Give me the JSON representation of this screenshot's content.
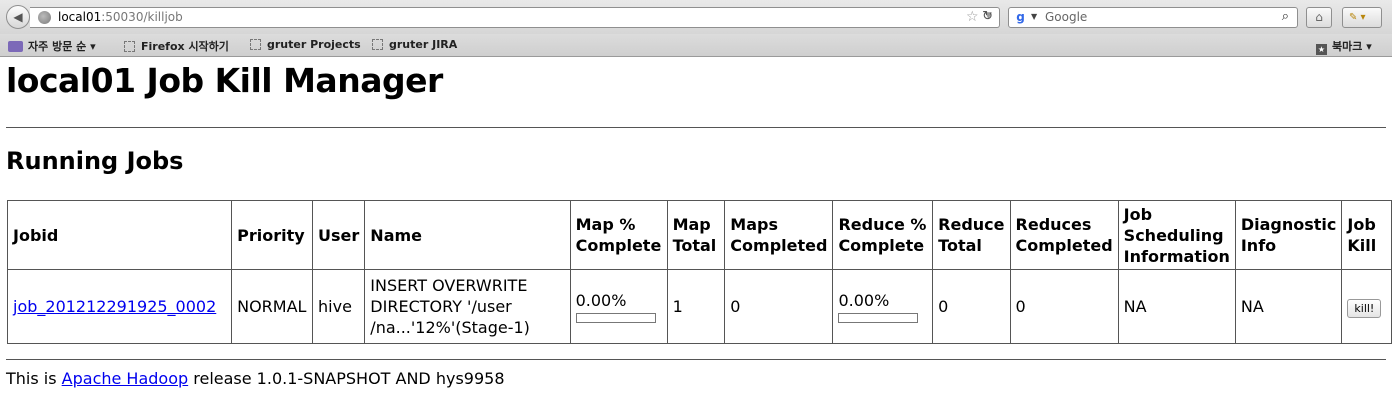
{
  "browser": {
    "url_host": "local01",
    "url_rest": ":50030/killjob",
    "search_placeholder": "Google",
    "bookmarks": [
      {
        "label": "자주 방문 순 ▾"
      },
      {
        "label": "Firefox 시작하기"
      },
      {
        "label": "gruter Projects"
      },
      {
        "label": "gruter JIRA"
      }
    ],
    "bookmarks_menu_label": "북마크 ▾"
  },
  "page": {
    "title": "local01 Job Kill Manager",
    "section_title": "Running Jobs"
  },
  "table": {
    "headers": {
      "jobid": "Jobid",
      "priority": "Priority",
      "user": "User",
      "name": "Name",
      "map_pct_1": "Map %",
      "map_pct_2": "Complete",
      "map_total_1": "Map",
      "map_total_2": "Total",
      "maps_completed_1": "Maps",
      "maps_completed_2": "Completed",
      "reduce_pct_1": "Reduce %",
      "reduce_pct_2": "Complete",
      "reduce_total_1": "Reduce",
      "reduce_total_2": "Total",
      "reduces_completed_1": "Reduces",
      "reduces_completed_2": "Completed",
      "sched_1": "Job",
      "sched_2": "Scheduling",
      "sched_3": "Information",
      "diag_1": "Diagnostic",
      "diag_2": "Info",
      "kill_1": "Job",
      "kill_2": "Kill"
    },
    "rows": [
      {
        "jobid": "job_201212291925_0002",
        "priority": "NORMAL",
        "user": "hive",
        "name_1": "INSERT OVERWRITE",
        "name_2": "DIRECTORY '/user",
        "name_3": "/na...'12%'(Stage-1)",
        "map_pct": "0.00%",
        "map_progress": 0,
        "map_total": "1",
        "maps_completed": "0",
        "reduce_pct": "0.00%",
        "reduce_progress": 0,
        "reduce_total": "0",
        "reduces_completed": "0",
        "sched_info": "NA",
        "diag_info": "NA",
        "kill_label": "kill!"
      }
    ]
  },
  "footer": {
    "prefix": "This is ",
    "link": "Apache Hadoop",
    "suffix": " release 1.0.1-SNAPSHOT AND hys9958"
  }
}
